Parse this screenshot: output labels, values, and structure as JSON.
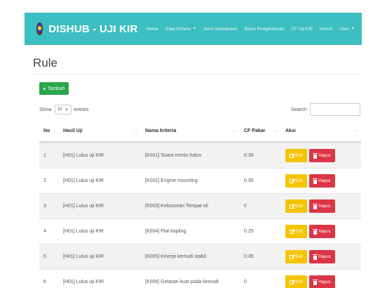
{
  "navbar": {
    "brand": "DISHUB - UJI KIR",
    "items": [
      {
        "label": "Home",
        "dropdown": false
      },
      {
        "label": "Data Kriteria",
        "dropdown": true
      },
      {
        "label": "Jenis Kendaraan",
        "dropdown": false
      },
      {
        "label": "Basis Pengetahuan",
        "dropdown": false
      },
      {
        "label": "CF Uji KIR",
        "dropdown": false
      },
      {
        "label": "Histori",
        "dropdown": false
      },
      {
        "label": "User",
        "dropdown": true
      }
    ],
    "color": "#3dbec0"
  },
  "page": {
    "title": "Rule"
  },
  "toolbar": {
    "add_label": "Tambah"
  },
  "entries": {
    "show_label": "Show",
    "value": "10",
    "suffix": "entries"
  },
  "search": {
    "label": "Search:"
  },
  "table": {
    "headers": [
      "No",
      "Hasil Uji",
      "Nama kriteria",
      "CF Pakar",
      "Aksi"
    ],
    "rows": [
      {
        "no": "1",
        "hasil": "[H01] Lulus uji KIR",
        "kriteria": "[K001] Suara mesin halus",
        "cf": "0.35"
      },
      {
        "no": "2",
        "hasil": "[H01] Lulus uji KIR",
        "kriteria": "[K002] Engine mounting",
        "cf": "0.35"
      },
      {
        "no": "3",
        "hasil": "[H01] Lulus uji KIR",
        "kriteria": "[K003] Kebocoran Tempat oli",
        "cf": "0"
      },
      {
        "no": "4",
        "hasil": "[H01] Lulus uji KIR",
        "kriteria": "[K004] Plat kopling",
        "cf": "0.25"
      },
      {
        "no": "5",
        "hasil": "[H01] Lulus uji KIR",
        "kriteria": "[K005] Kinerja kemudi stabil",
        "cf": "0.35"
      },
      {
        "no": "6",
        "hasil": "[H01] Lulus uji KIR",
        "kriteria": "[K006] Getaran kuat pada kemudi",
        "cf": "0"
      }
    ],
    "edit_label": "Edit",
    "delete_label": "Hapus"
  },
  "colors": {
    "add": "#2aa548",
    "edit": "#f5c400",
    "delete": "#dc3545"
  }
}
